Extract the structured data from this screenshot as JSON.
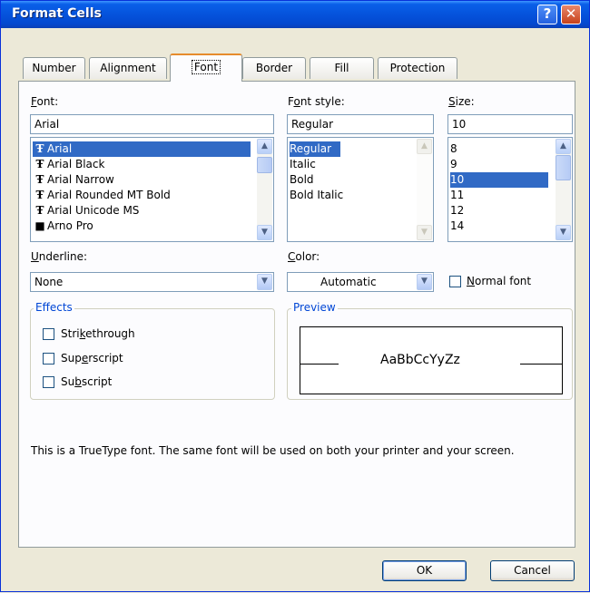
{
  "window": {
    "title": "Format Cells",
    "help_glyph": "?",
    "close_glyph": "✕"
  },
  "tabs": [
    {
      "label": "Number"
    },
    {
      "label": "Alignment"
    },
    {
      "label": "Font"
    },
    {
      "label": "Border"
    },
    {
      "label": "Fill"
    },
    {
      "label": "Protection"
    }
  ],
  "active_tab": "Font",
  "font": {
    "label_accel": "F",
    "label_rest": "ont:",
    "value": "Arial",
    "items": [
      "Arial",
      "Arial Black",
      "Arial Narrow",
      "Arial Rounded MT Bold",
      "Arial Unicode MS",
      "Arno Pro"
    ],
    "selected": "Arial"
  },
  "font_style": {
    "label_pre": "F",
    "label_accel": "o",
    "label_rest": "nt style:",
    "value": "Regular",
    "items": [
      "Regular",
      "Italic",
      "Bold",
      "Bold Italic"
    ],
    "selected": "Regular"
  },
  "size": {
    "label_accel": "S",
    "label_rest": "ize:",
    "value": "10",
    "items": [
      "8",
      "9",
      "10",
      "11",
      "12",
      "14"
    ],
    "selected": "10"
  },
  "underline": {
    "label_accel": "U",
    "label_rest": "nderline:",
    "value": "None"
  },
  "color": {
    "label_accel": "C",
    "label_rest": "olor:",
    "value": "Automatic"
  },
  "normal_font": {
    "label_accel": "N",
    "label_rest": "ormal font",
    "checked": false
  },
  "effects": {
    "title": "Effects",
    "strikethrough": {
      "pre": "Stri",
      "accel": "k",
      "rest": "ethrough",
      "checked": false
    },
    "superscript": {
      "pre": "Sup",
      "accel": "e",
      "rest": "rscript",
      "checked": false
    },
    "subscript": {
      "pre": "Su",
      "accel": "b",
      "rest": "script",
      "checked": false
    }
  },
  "preview": {
    "title": "Preview",
    "sample": "AaBbCcYyZz"
  },
  "info_text": "This is a TrueType font.  The same font will be used on both your printer and your screen.",
  "buttons": {
    "ok": "OK",
    "cancel": "Cancel"
  },
  "colors": {
    "titlebar": "#0553dc",
    "selection": "#316ac5",
    "group_title": "#0046d5",
    "active_tab_accent": "#e68b2c"
  }
}
